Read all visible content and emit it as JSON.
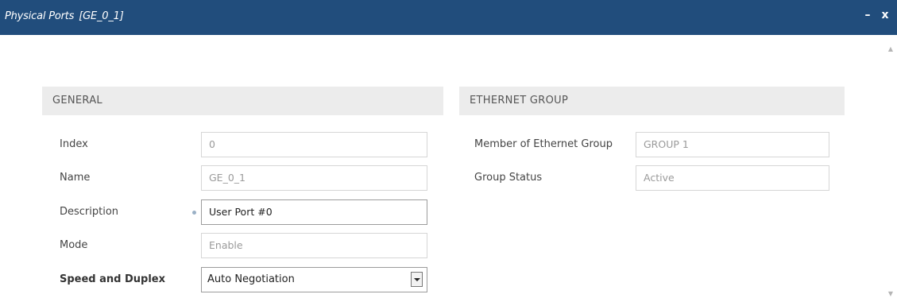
{
  "window": {
    "title": "Physical Ports",
    "subtitle": "[GE_0_1]",
    "minimize_label": "–",
    "close_label": "x"
  },
  "general": {
    "heading": "GENERAL",
    "index_label": "Index",
    "index_value": "0",
    "name_label": "Name",
    "name_value": "GE_0_1",
    "description_label": "Description",
    "description_value": "User Port #0",
    "mode_label": "Mode",
    "mode_value": "Enable",
    "speed_label": "Speed and Duplex",
    "speed_value": "Auto Negotiation"
  },
  "ethernet_group": {
    "heading": "ETHERNET GROUP",
    "member_label": "Member of Ethernet Group",
    "member_value": "GROUP 1",
    "status_label": "Group Status",
    "status_value": "Active"
  }
}
